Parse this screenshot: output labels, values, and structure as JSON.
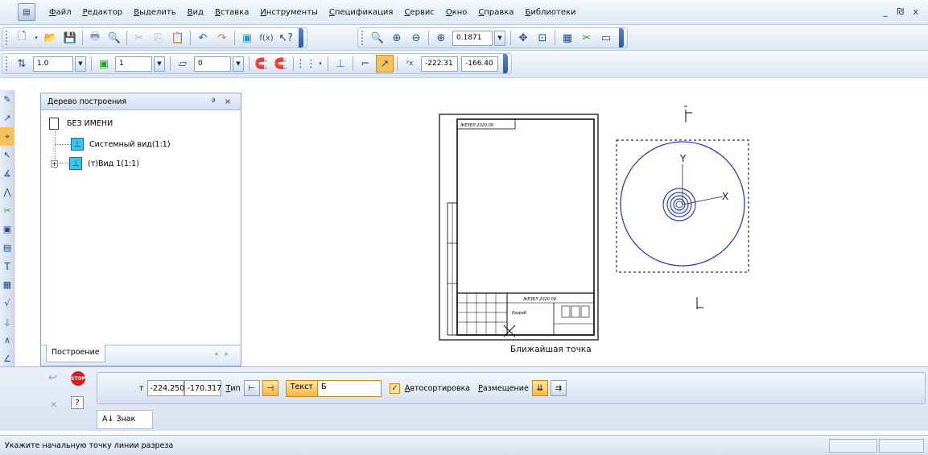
{
  "menu": {
    "items": [
      "Файл",
      "Редактор",
      "Выделить",
      "Вид",
      "Вставка",
      "Инструменты",
      "Спецификация",
      "Сервис",
      "Окно",
      "Справка",
      "Библиотеки"
    ],
    "window_controls": "_ ₪ x"
  },
  "toolbar_standard": {
    "zoom_value": "0.1871"
  },
  "toolbar_current_state": {
    "style_value": "1.0",
    "step_value": "1",
    "layer_value": "0",
    "coord_x": "-222.31",
    "coord_y": "-166.40"
  },
  "tree_panel": {
    "title": "Дерево построения",
    "header_controls": "ª ×",
    "root": "БЕЗ ИМЕНИ",
    "nodes": [
      "Системный вид(1:1)",
      "(т)Вид 1(1:1)"
    ],
    "footer_tab": "Построение",
    "nav_arrows": "◂ ▸"
  },
  "drawing": {
    "hint": "Ближайшая точка",
    "axis_x": "X",
    "axis_y": "Y",
    "stamp_top": "ЖЕЗЕЛ.2020.09",
    "stamp_main": "ЖЕЗЕЛ.2020.09",
    "stamp_small": "Разраб"
  },
  "properties": {
    "point_label": "т",
    "x_value": "-224.250",
    "y_value": "-170.317",
    "type_label": "Тип",
    "text_label": "Текст",
    "text_value": "Б",
    "autosort_label": "Автосортировка",
    "placement_label": "Размещение",
    "tab_label": "Знак",
    "tab_prefix": "A↓"
  },
  "status": {
    "message": "Укажите начальную точку линии разреза"
  },
  "colors": {
    "accent_blue": "#2a58a3",
    "view_icon": "#39c5e8",
    "circle_blue": "#2b3fc0",
    "highlight_orange": "#f6b63e"
  }
}
